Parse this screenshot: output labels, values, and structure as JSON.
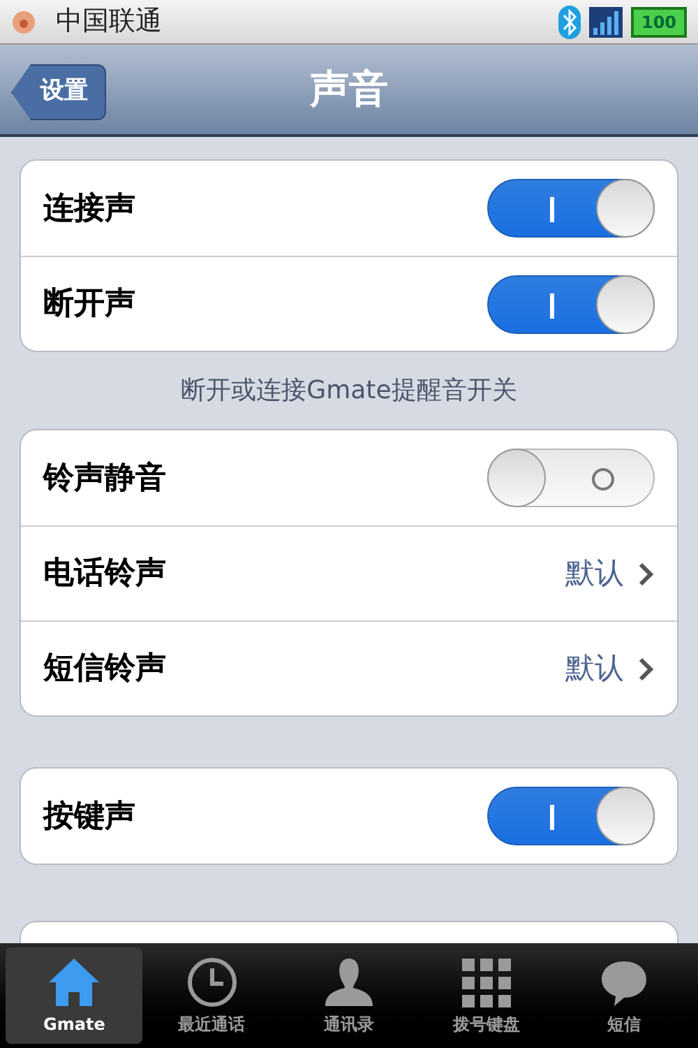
{
  "status_bar": {
    "carrier": "中国联通",
    "battery": "100"
  },
  "nav_bar": {
    "back": "设置",
    "title": "声音"
  },
  "groups": [
    {
      "rows": [
        {
          "kind": "toggle",
          "label": "连接声",
          "on": true
        },
        {
          "kind": "toggle",
          "label": "断开声",
          "on": true
        }
      ],
      "footer": "断开或连接Gmate提醒音开关"
    },
    {
      "rows": [
        {
          "kind": "toggle",
          "label": "铃声静音",
          "on": false
        },
        {
          "kind": "link",
          "label": "电话铃声",
          "value": "默认"
        },
        {
          "kind": "link",
          "label": "短信铃声",
          "value": "默认"
        }
      ]
    },
    {
      "rows": [
        {
          "kind": "toggle",
          "label": "按键声",
          "on": true
        }
      ]
    }
  ],
  "tab_bar": [
    {
      "label": "Gmate",
      "kind": "home",
      "selected": true
    },
    {
      "label": "最近通话",
      "kind": "clock",
      "selected": false
    },
    {
      "label": "通讯录",
      "kind": "person",
      "selected": false
    },
    {
      "label": "拨号键盘",
      "kind": "keypad",
      "selected": false
    },
    {
      "label": "短信",
      "kind": "bubble",
      "selected": false
    }
  ]
}
